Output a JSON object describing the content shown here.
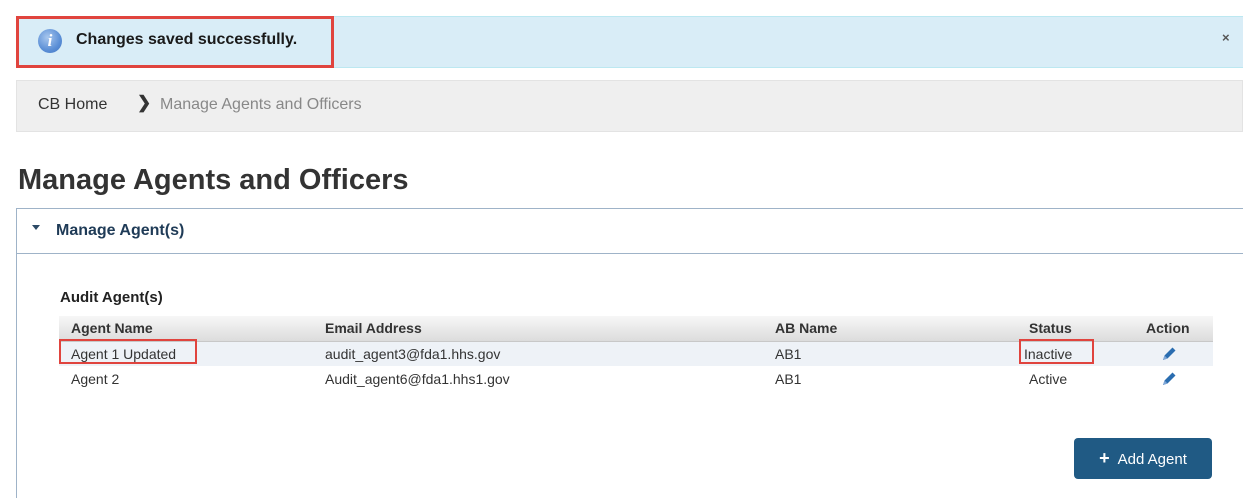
{
  "alert": {
    "icon": "info-icon",
    "message": "Changes saved successfully.",
    "close_label": "×"
  },
  "breadcrumb": {
    "home": "CB Home",
    "separator_icon": "chevron-right-icon",
    "current": "Manage Agents and Officers"
  },
  "page": {
    "title": "Manage Agents and Officers"
  },
  "panel": {
    "title": "Manage Agent(s)",
    "expanded": true
  },
  "audit_agents": {
    "section_title": "Audit Agent(s)",
    "columns": [
      "Agent Name",
      "Email Address",
      "AB Name",
      "Status",
      "Action"
    ],
    "rows": [
      {
        "name": "Agent 1 Updated",
        "email": "audit_agent3@fda1.hhs.gov",
        "ab_name": "AB1",
        "status": "Inactive",
        "action_icon": "pencil-icon"
      },
      {
        "name": "Agent 2",
        "email": "Audit_agent6@fda1.hhs1.gov",
        "ab_name": "AB1",
        "status": "Active",
        "action_icon": "pencil-icon"
      }
    ]
  },
  "add_button": {
    "icon": "plus-icon",
    "label": "Add Agent"
  },
  "colors": {
    "alert_bg": "#d9edf7",
    "highlight": "#e0443e",
    "primary_button": "#205a84",
    "panel_title": "#1f3b57",
    "edit_icon": "#2a6db0"
  }
}
